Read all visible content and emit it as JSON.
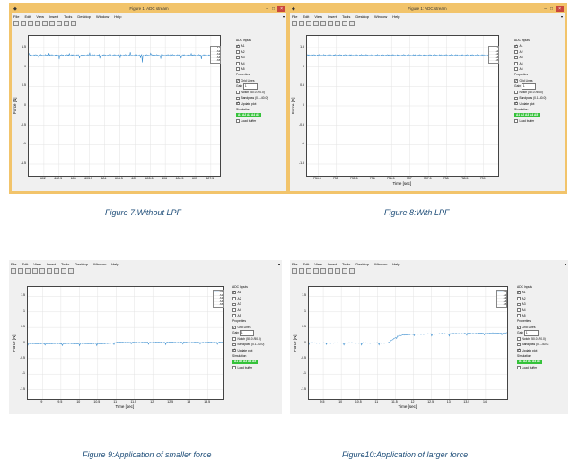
{
  "figures": [
    {
      "window_title": "Figure 1: ADC stream",
      "menu": [
        "File",
        "Edit",
        "View",
        "Insert",
        "Tools",
        "Desktop",
        "Window",
        "Help"
      ],
      "ylabel": "Force [N]",
      "xlabel": "",
      "yticks": [
        "1.5",
        "1",
        "0.5",
        "0",
        "-0.5",
        "-1",
        "-1.5"
      ],
      "xticks": [
        "602",
        "602.5",
        "603",
        "603.5",
        "604",
        "604.5",
        "605",
        "605.5",
        "606",
        "606.5",
        "607",
        "607.5"
      ],
      "legend": [
        "A1",
        "A2",
        "A3",
        "A4",
        "A5"
      ],
      "side": {
        "adc_inputs": "ADC Inputs",
        "inputs": [
          "A1",
          "A2",
          "A3",
          "A4",
          "A5"
        ],
        "properties": "Properties",
        "grid_lines": "Grid Lines",
        "gain_label": "Gain",
        "gain_value": "1",
        "notch": "Notch (50.0 /50.0)",
        "bandpass": "Bandpass (0.1-40.0)",
        "update_plot": "Update plot",
        "simulation": "Simulation",
        "sim_chips": "A1 A2 A3 A4 A5",
        "load_buffer": "Load buffer"
      },
      "chart_data": {
        "type": "line",
        "series": [
          {
            "name": "A1",
            "description": "constant force signal with noise and spikes",
            "level": 1.3
          }
        ],
        "ylim": [
          -1.8,
          1.8
        ],
        "xlim": [
          601.5,
          607.8
        ],
        "xlabel": "",
        "ylabel": "Force [N]"
      }
    },
    {
      "window_title": "Figure 1: ADC stream",
      "menu": [
        "File",
        "Edit",
        "View",
        "Insert",
        "Tools",
        "Desktop",
        "Window",
        "Help"
      ],
      "ylabel": "Force [N]",
      "xlabel": "Time [sec]",
      "yticks": [
        "1.5",
        "1",
        "0.5",
        "0",
        "-0.5",
        "-1",
        "-1.5"
      ],
      "xticks": [
        "734.5",
        "735",
        "735.5",
        "736",
        "736.5",
        "737",
        "737.5",
        "738",
        "738.5",
        "739"
      ],
      "legend": [
        "A1",
        "A2",
        "A3",
        "A4",
        "A5"
      ],
      "side": {
        "adc_inputs": "ADC Inputs",
        "inputs": [
          "A1",
          "A2",
          "A3",
          "A4",
          "A5"
        ],
        "properties": "Properties",
        "grid_lines": "Grid Lines",
        "gain_label": "Gain",
        "gain_value": "1",
        "notch": "Notch (50.0 /50.0)",
        "bandpass": "Bandpass (0.1-40.0)",
        "update_plot": "Update plot",
        "simulation": "Simulation",
        "sim_chips": "A1 A2 A3 A4 A5",
        "load_buffer": "Load buffer"
      },
      "chart_data": {
        "type": "line",
        "series": [
          {
            "name": "A1",
            "level": 1.3
          }
        ],
        "ylim": [
          -1.8,
          1.8
        ],
        "xlim": [
          734.2,
          739.4
        ],
        "xlabel": "Time [sec]",
        "ylabel": "Force [N]"
      }
    },
    {
      "window_title": "",
      "menu": [
        "File",
        "Edit",
        "View",
        "Insert",
        "Tools",
        "Desktop",
        "Window",
        "Help"
      ],
      "ylabel": "Force [N]",
      "xlabel": "Time [sec]",
      "yticks": [
        "1.5",
        "1",
        "0.5",
        "0",
        "-0.5",
        "-1",
        "-1.5"
      ],
      "xticks": [
        "9",
        "9.5",
        "10",
        "10.5",
        "11",
        "11.5",
        "12",
        "12.5",
        "13",
        "13.5"
      ],
      "legend": [
        "A1",
        "A2",
        "A3",
        "A4",
        "A5"
      ],
      "side": {
        "adc_inputs": "ADC Inputs",
        "inputs": [
          "A1",
          "A2",
          "A3",
          "A4",
          "A5"
        ],
        "properties": "Properties",
        "grid_lines": "Grid Lines",
        "gain_label": "Gain",
        "gain_value": "1",
        "notch": "Notch (50.0 /50.0)",
        "bandpass": "Bandpass (0.1-40.0)",
        "update_plot": "Update plot",
        "simulation": "Simulation",
        "sim_chips": "A1 A2 A3 A4 A5",
        "load_buffer": "Load buffer"
      },
      "chart_data": {
        "type": "line",
        "series": [
          {
            "name": "A1",
            "points": [
              [
                8.6,
                -0.02
              ],
              [
                10.8,
                -0.02
              ],
              [
                11.0,
                0.02
              ],
              [
                13.8,
                0.02
              ]
            ]
          }
        ],
        "ylim": [
          -1.8,
          1.8
        ],
        "xlim": [
          8.6,
          13.9
        ],
        "xlabel": "Time [sec]",
        "ylabel": "Force [N]"
      }
    },
    {
      "window_title": "",
      "menu": [
        "File",
        "Edit",
        "View",
        "Insert",
        "Tools",
        "Desktop",
        "Window",
        "Help"
      ],
      "ylabel": "Force [N]",
      "xlabel": "Time [sec]",
      "yticks": [
        "1.5",
        "1",
        "0.5",
        "0",
        "-0.5",
        "-1",
        "-1.5"
      ],
      "xticks": [
        "9.5",
        "10",
        "10.5",
        "11",
        "11.5",
        "12",
        "12.5",
        "13",
        "13.5",
        "14"
      ],
      "legend": [
        "A1",
        "A2",
        "A3",
        "A4",
        "A5"
      ],
      "side": {
        "adc_inputs": "ADC Inputs",
        "inputs": [
          "A1",
          "A2",
          "A3",
          "A4",
          "A5"
        ],
        "properties": "Properties",
        "grid_lines": "Grid Lines",
        "gain_label": "Gain",
        "gain_value": "1",
        "notch": "Notch (50.0 /50.0)",
        "bandpass": "Bandpass (0.1-40.0)",
        "update_plot": "Update plot",
        "simulation": "Simulation",
        "sim_chips": "A1 A2 A3 A4 A5",
        "load_buffer": "Load buffer"
      },
      "chart_data": {
        "type": "line",
        "series": [
          {
            "name": "A1",
            "points": [
              [
                9.1,
                0.0
              ],
              [
                11.3,
                0.0
              ],
              [
                11.55,
                0.22
              ],
              [
                11.9,
                0.28
              ],
              [
                14.5,
                0.32
              ]
            ]
          }
        ],
        "ylim": [
          -1.8,
          1.8
        ],
        "xlim": [
          9.1,
          14.6
        ],
        "xlabel": "Time [sec]",
        "ylabel": "Force [N]"
      }
    }
  ],
  "captions": [
    "Figure 7:Without LPF",
    "Figure 8:With LPF",
    "Figure 9:Application of smaller force",
    "Figure10:Application of larger force"
  ],
  "colors": {
    "accent": "#f2c46b",
    "signal": "#3c8fd0",
    "caption": "#1f4e79",
    "chip": "#35c23a"
  }
}
